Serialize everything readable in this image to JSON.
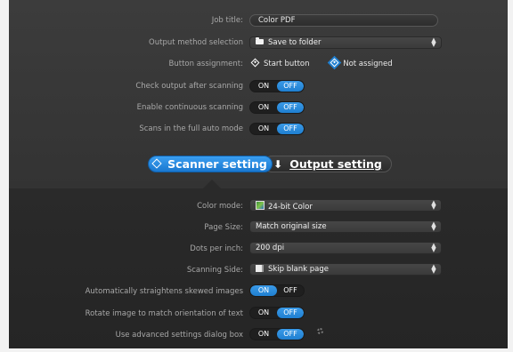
{
  "output": {
    "job_title_label": "Job title:",
    "job_title_value": "Color PDF",
    "output_method_label": "Output method selection",
    "output_method_value": "Save to folder",
    "button_assignment_label": "Button assignment:",
    "button_assignment_options": [
      "Start button",
      "Not assigned"
    ],
    "button_assignment_selected": "Not assigned",
    "check_output_label": "Check output after scanning",
    "check_output_state": "OFF",
    "continuous_label": "Enable continuous scanning",
    "continuous_state": "OFF",
    "full_auto_label": "Scans in the full auto mode",
    "full_auto_state": "OFF"
  },
  "tabs": {
    "scanner_label": "Scanner setting",
    "output_label": "Output setting",
    "active": "Scanner setting"
  },
  "scanner": {
    "color_mode_label": "Color mode:",
    "color_mode_value": "24-bit Color",
    "page_size_label": "Page Size:",
    "page_size_value": "Match original size",
    "dpi_label": "Dots per inch:",
    "dpi_value": "200 dpi",
    "side_label": "Scanning Side:",
    "side_value": "Skip blank page",
    "straighten_label": "Automatically straightens skewed images",
    "straighten_state": "ON",
    "rotate_label": "Rotate image to match orientation of text",
    "rotate_state": "OFF",
    "advanced_label": "Use advanced settings dialog box",
    "advanced_state": "OFF"
  },
  "toggle": {
    "on_text": "ON",
    "off_text": "OFF"
  },
  "colors": {
    "accent": "#1f7fd0",
    "panel": "#333333",
    "label": "#a8a8a8"
  },
  "icons": {
    "output_method": "folder-icon",
    "color_mode": "color-image-icon",
    "scanning_side": "blank-page-icon",
    "scanner_tab": "diamond-icon",
    "output_tab": "down-arrow-icon",
    "advanced": "gear-icon"
  }
}
